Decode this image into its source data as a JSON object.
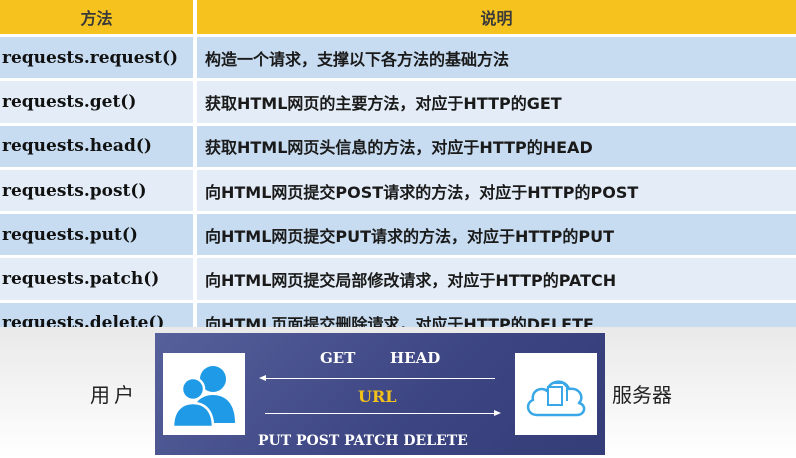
{
  "table": {
    "headers": [
      "方法",
      "说明"
    ],
    "rows": [
      {
        "method": "requests.request()",
        "desc": "构造一个请求，支撑以下各方法的基础方法"
      },
      {
        "method": "requests.get()",
        "desc": "获取HTML网页的主要方法，对应于HTTP的GET"
      },
      {
        "method": "requests.head()",
        "desc": "获取HTML网页头信息的方法，对应于HTTP的HEAD"
      },
      {
        "method": "requests.post()",
        "desc": "向HTML网页提交POST请求的方法，对应于HTTP的POST"
      },
      {
        "method": "requests.put()",
        "desc": "向HTML网页提交PUT请求的方法，对应于HTTP的PUT"
      },
      {
        "method": "requests.patch()",
        "desc": "向HTML网页提交局部修改请求，对应于HTTP的PATCH"
      },
      {
        "method": "requests.delete()",
        "desc": "向HTML页面提交删除请求，对应于HTTP的DELETE"
      }
    ]
  },
  "diagram": {
    "user_label": "用户",
    "server_label": "服务器",
    "top_methods": [
      "GET",
      "HEAD"
    ],
    "center_label": "URL",
    "bottom_methods": "PUT  POST  PATCH  DELETE",
    "icons": {
      "user": "users-icon",
      "server": "cloud-document-icon"
    },
    "colors": {
      "panel": "#3c4582",
      "url_text": "#f3c21a",
      "user_icon": "#1e9ae6",
      "cloud_icon": "#3aa8e6",
      "header": "#f6c21d"
    }
  }
}
